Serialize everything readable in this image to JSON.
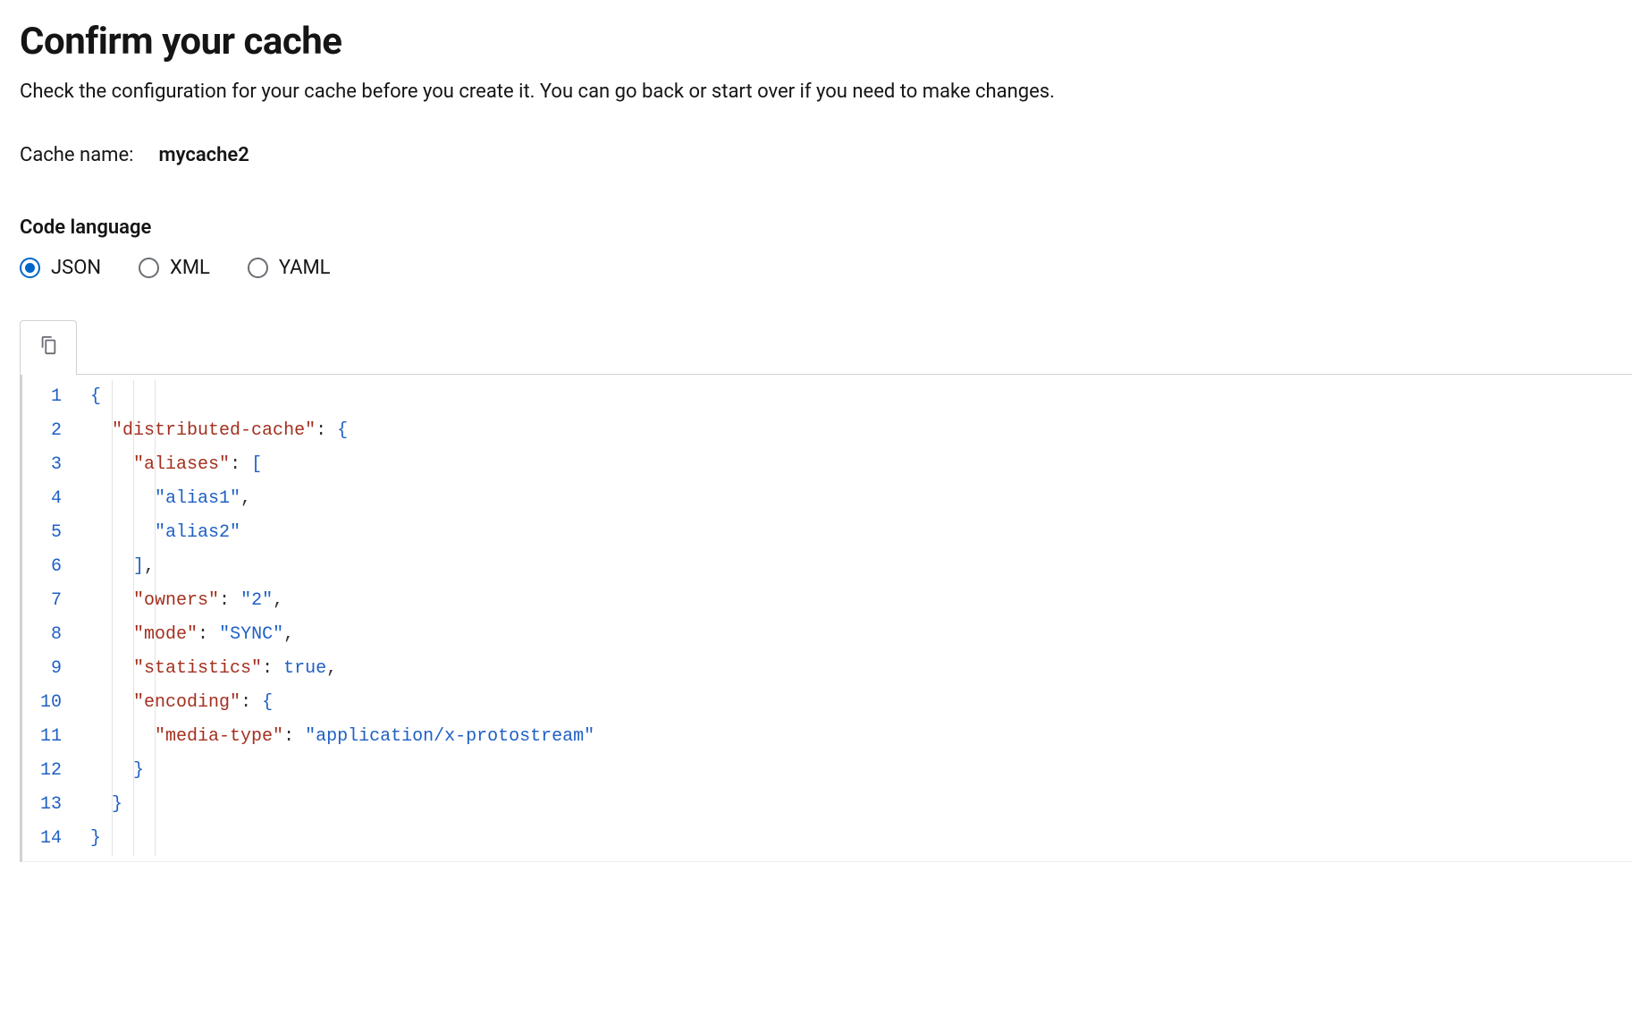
{
  "header": {
    "title": "Confirm your cache",
    "description": "Check the configuration for your cache before you create it. You can go back or start over if you need to make changes."
  },
  "cache_name": {
    "label": "Cache name:",
    "value": "mycache2"
  },
  "code_language": {
    "label": "Code language",
    "options": [
      "JSON",
      "XML",
      "YAML"
    ],
    "selected": "JSON"
  },
  "toolbar": {
    "copy_tooltip": "Copy"
  },
  "code": {
    "line_count": 14,
    "tokens": [
      [
        {
          "t": "brace",
          "v": "{"
        }
      ],
      [
        {
          "t": "indent",
          "n": 1
        },
        {
          "t": "key",
          "v": "\"distributed-cache\""
        },
        {
          "t": "punct",
          "v": ": "
        },
        {
          "t": "brace",
          "v": "{"
        }
      ],
      [
        {
          "t": "indent",
          "n": 2
        },
        {
          "t": "key",
          "v": "\"aliases\""
        },
        {
          "t": "punct",
          "v": ": "
        },
        {
          "t": "bracket",
          "v": "["
        }
      ],
      [
        {
          "t": "indent",
          "n": 3
        },
        {
          "t": "string",
          "v": "\"alias1\""
        },
        {
          "t": "punct",
          "v": ","
        }
      ],
      [
        {
          "t": "indent",
          "n": 3
        },
        {
          "t": "string",
          "v": "\"alias2\""
        }
      ],
      [
        {
          "t": "indent",
          "n": 2
        },
        {
          "t": "bracket",
          "v": "]"
        },
        {
          "t": "punct",
          "v": ","
        }
      ],
      [
        {
          "t": "indent",
          "n": 2
        },
        {
          "t": "key",
          "v": "\"owners\""
        },
        {
          "t": "punct",
          "v": ": "
        },
        {
          "t": "string",
          "v": "\"2\""
        },
        {
          "t": "punct",
          "v": ","
        }
      ],
      [
        {
          "t": "indent",
          "n": 2
        },
        {
          "t": "key",
          "v": "\"mode\""
        },
        {
          "t": "punct",
          "v": ": "
        },
        {
          "t": "string",
          "v": "\"SYNC\""
        },
        {
          "t": "punct",
          "v": ","
        }
      ],
      [
        {
          "t": "indent",
          "n": 2
        },
        {
          "t": "key",
          "v": "\"statistics\""
        },
        {
          "t": "punct",
          "v": ": "
        },
        {
          "t": "bool",
          "v": "true"
        },
        {
          "t": "punct",
          "v": ","
        }
      ],
      [
        {
          "t": "indent",
          "n": 2
        },
        {
          "t": "key",
          "v": "\"encoding\""
        },
        {
          "t": "punct",
          "v": ": "
        },
        {
          "t": "brace",
          "v": "{"
        }
      ],
      [
        {
          "t": "indent",
          "n": 3
        },
        {
          "t": "key",
          "v": "\"media-type\""
        },
        {
          "t": "punct",
          "v": ": "
        },
        {
          "t": "string",
          "v": "\"application/x-protostream\""
        }
      ],
      [
        {
          "t": "indent",
          "n": 2
        },
        {
          "t": "brace",
          "v": "}"
        }
      ],
      [
        {
          "t": "indent",
          "n": 1
        },
        {
          "t": "brace",
          "v": "}"
        }
      ],
      [
        {
          "t": "brace",
          "v": "}"
        }
      ]
    ]
  }
}
